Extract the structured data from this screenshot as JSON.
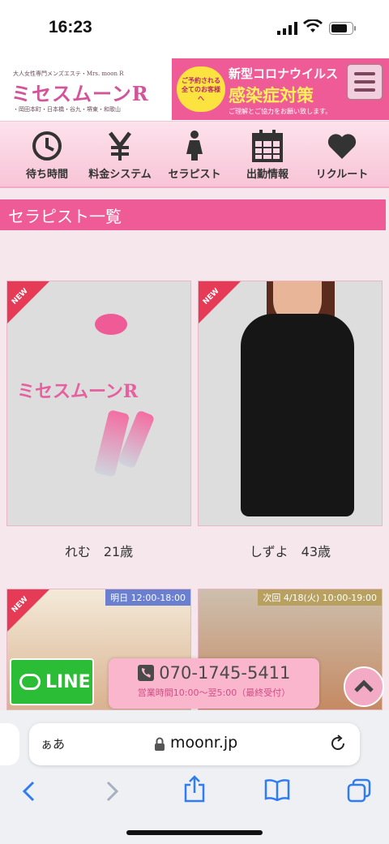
{
  "status_bar": {
    "time": "16:23"
  },
  "header": {
    "logo_tagline": "大人女性専門メンズエステ・Mrs. moon R",
    "logo_name": "ミセスムーンR",
    "logo_areas": "・岡田本町・日本橋・谷九・堺東・和歌山",
    "covid_circle": "ご予約される全てのお客様へ",
    "covid_line1": "新型コロナウイルス",
    "covid_line2": "感染症対策",
    "covid_line3": "ご理解とご協力をお願い致します。"
  },
  "nav": {
    "items": [
      {
        "label": "待ち時間",
        "icon": "clock-icon"
      },
      {
        "label": "料金システム",
        "icon": "yen-icon"
      },
      {
        "label": "セラピスト",
        "icon": "person-icon"
      },
      {
        "label": "出勤情報",
        "icon": "calendar-icon"
      },
      {
        "label": "リクルート",
        "icon": "heart-icon"
      }
    ]
  },
  "section_title": "セラピスト一覧",
  "therapists": [
    {
      "name": "れむ　21歳",
      "badge": "NEW",
      "logo_text": "ミセスムーンR"
    },
    {
      "name": "しずよ　43歳",
      "badge": "NEW"
    },
    {
      "badge": "NEW",
      "schedule": "明日 12:00-18:00"
    },
    {
      "schedule": "次回 4/18(火) 10:00-19:00"
    }
  ],
  "contact": {
    "line_label": "LINE",
    "phone": "070-1745-5411",
    "hours": "営業時間10:00～翌5:00（最終受付）"
  },
  "browser": {
    "aa_label": "ぁあ",
    "url": "moonr.jp"
  },
  "colors": {
    "accent_pink": "#ee5b97",
    "line_green": "#2bbd35",
    "new_badge_red": "#e63b56",
    "schedule_blue": "#6a7fd0",
    "schedule_gold": "#b8a160"
  }
}
